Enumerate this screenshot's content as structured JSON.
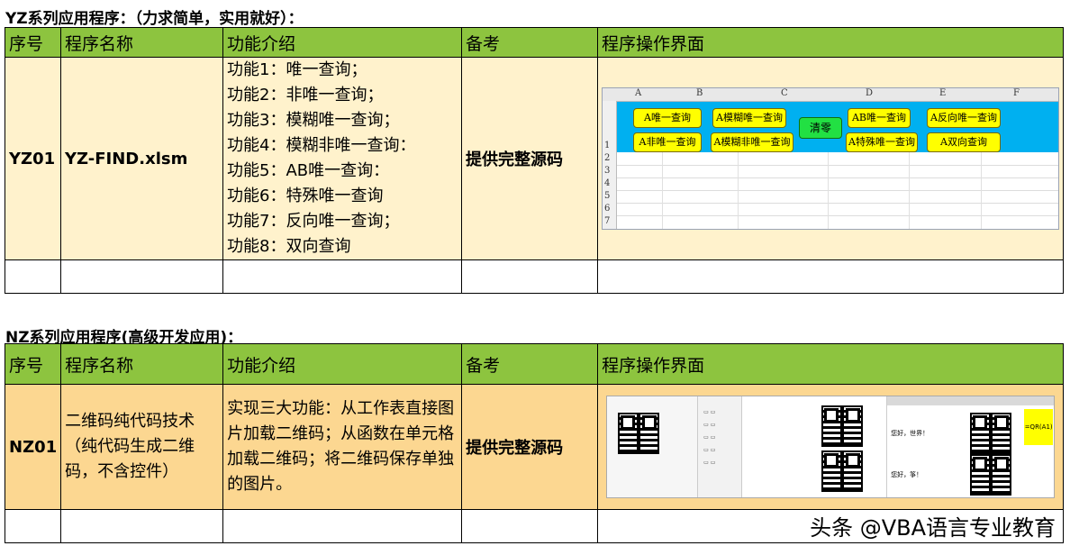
{
  "section1": {
    "title": "YZ系列应用程序：（力求简单，实用就好）：",
    "headers": [
      "序号",
      "程序名称",
      "功能介绍",
      "备考",
      "程序操作界面"
    ],
    "row": {
      "id": "YZ01",
      "name": "YZ-FIND.xlsm",
      "functions": [
        "功能1：唯一查询；",
        "功能2：非唯一查询；",
        "功能3：模糊唯一查询；",
        "功能4：模糊非唯一查询：",
        "功能5：AB唯一查询：",
        "功能6：特殊唯一查询",
        "功能7：反向唯一查询；",
        "功能8：双向查询"
      ],
      "remark": "提供完整源码"
    },
    "screenshot": {
      "columns": [
        "A",
        "B",
        "C",
        "D",
        "E",
        "F"
      ],
      "rows": [
        "1",
        "2",
        "3",
        "4",
        "5",
        "6",
        "7"
      ],
      "buttons": {
        "b1": "A唯一查询",
        "b2": "A模糊唯一查询",
        "b3": "清零",
        "b4": "AB唯一查询",
        "b5": "A反向唯一查询",
        "b6": "A非唯一查询",
        "b7": "A模糊非唯一查询",
        "b8": "A特殊唯一查询",
        "b9": "A双向查询"
      }
    }
  },
  "section2": {
    "title": "NZ系列应用程序(高级开发应用)：",
    "headers": [
      "序号",
      "程序名称",
      "功能介绍",
      "备考",
      "程序操作界面"
    ],
    "row": {
      "id": "NZ01",
      "name": "二维码纯代码技术（纯代码生成二维码，不含控件）",
      "description": "实现三大功能：从工作表直接图片加载二维码；从函数在单元格加载二维码；将二维码保存单独的图片。",
      "remark": "提供完整源码"
    },
    "screenshot": {
      "cell_text_1": "您好，世界！",
      "cell_text_2": "您好，筝！",
      "formula": "=QR(A1)"
    }
  },
  "watermark": "头条 @VBA语言专业教育"
}
